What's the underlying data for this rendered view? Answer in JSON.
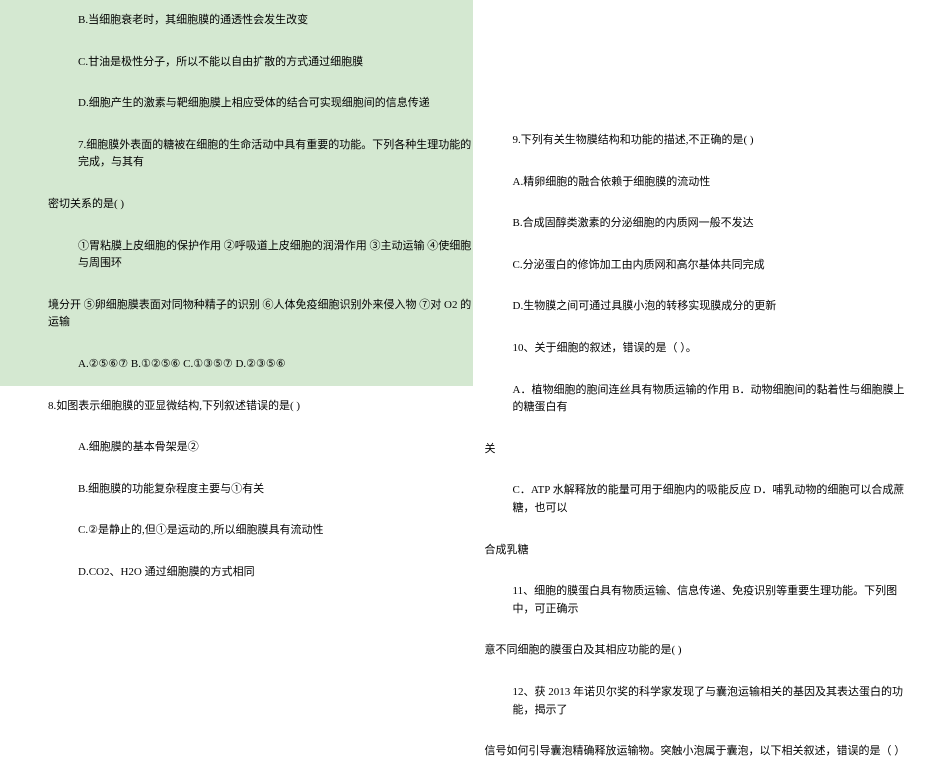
{
  "left": {
    "highlighted": [
      "B.当细胞衰老时，其细胞膜的通透性会发生改变",
      "C.甘油是极性分子，所以不能以自由扩散的方式通过细胞膜",
      "D.细胞产生的激素与靶细胞膜上相应受体的结合可实现细胞间的信息传递",
      "7.细胞膜外表面的糖被在细胞的生命活动中具有重要的功能。下列各种生理功能的完成，与其有",
      "密切关系的是(    )",
      "①胃粘膜上皮细胞的保护作用  ②呼吸道上皮细胞的润滑作用  ③主动运输  ④使细胞与周围环",
      "境分开  ⑤卵细胞膜表面对同物种精子的识别  ⑥人体免疫细胞识别外来侵入物  ⑦对 O2 的运输",
      "A.②⑤⑥⑦  B.①②⑤⑥  C.①③⑤⑦  D.②③⑤⑥"
    ],
    "q8_intro": "8.如图表示细胞膜的亚显微结构,下列叙述错误的是(    )",
    "q8_options": [
      "A.细胞膜的基本骨架是②",
      "B.细胞膜的功能复杂程度主要与①有关",
      "C.②是静止的,但①是运动的,所以细胞膜具有流动性",
      "D.CO2、H2O 通过细胞膜的方式相同"
    ]
  },
  "right": {
    "q9_intro": "9.下列有关生物膜结构和功能的描述,不正确的是(    )",
    "q9_options": [
      "A.精卵细胞的融合依赖于细胞膜的流动性",
      "B.合成固醇类激素的分泌细胞的内质网一般不发达",
      "C.分泌蛋白的修饰加工由内质网和高尔基体共同完成",
      "D.生物膜之间可通过具膜小泡的转移实现膜成分的更新"
    ],
    "q10_intro": "10、关于细胞的叙述，错误的是（    ）。",
    "q10_line1": "A．植物细胞的胞间连丝具有物质运输的作用   B．动物细胞间的黏着性与细胞膜上的糖蛋白有",
    "q10_line2": "关",
    "q10_line3": "C．ATP 水解释放的能量可用于细胞内的吸能反应 D．哺乳动物的细胞可以合成蔗糖，也可以",
    "q10_line4": "合成乳糖",
    "q11_line1": "11、细胞的膜蛋白具有物质运输、信息传递、免疫识别等重要生理功能。下列图中，可正确示",
    "q11_line2": "意不同细胞的膜蛋白及其相应功能的是(    )",
    "q12_line1": "12、获 2013 年诺贝尔奖的科学家发现了与囊泡运输相关的基因及其表达蛋白的功能，揭示了",
    "q12_line2": "信号如何引导囊泡精确释放运输物。突触小泡属于囊泡，以下相关叙述，错误的是（   ）"
  }
}
